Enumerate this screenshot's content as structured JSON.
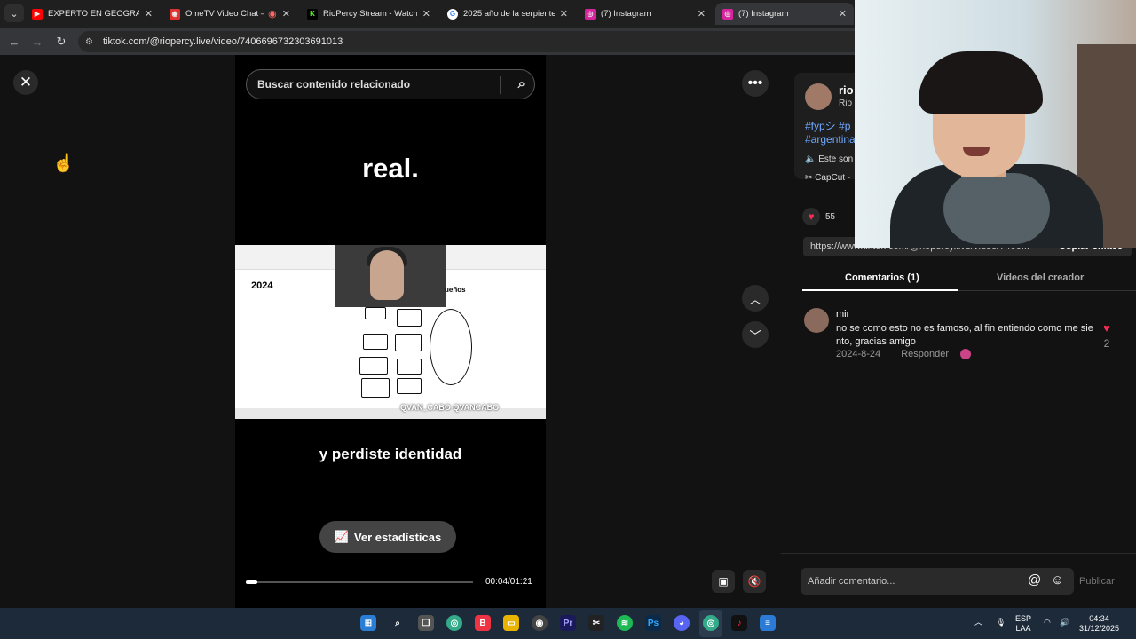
{
  "browser": {
    "tabs": [
      {
        "label": "EXPERTO EN GEOGRAFÍA",
        "icon": "youtube-icon",
        "color": "#ff0000"
      },
      {
        "label": "OmeTV Video Chat –",
        "icon": "ometv-icon",
        "color": "#e0312f"
      },
      {
        "label": "RioPercy Stream - Watch L",
        "icon": "kick-icon",
        "color": "#53fc18"
      },
      {
        "label": "2025 año de la serpiente",
        "icon": "google-icon",
        "color": "#4285f4"
      },
      {
        "label": "(7) Instagram",
        "icon": "instagram-icon",
        "color": "#d6249f"
      },
      {
        "label": "(7) Instagram",
        "icon": "instagram-icon",
        "color": "#d6249f"
      }
    ],
    "url": "tiktok.com/@riopercy.live/video/7406696732303691013"
  },
  "player": {
    "search_placeholder": "Buscar contenido relacionado",
    "caption_top": "real.",
    "caption_bottom": "y perdiste identidad",
    "frame_year": "2024",
    "frame_word": "ueños",
    "watermark": "QVAN_CABO   QVANCABO",
    "stats_label": "Ver estadísticas",
    "time": "00:04/01:21",
    "progress": 0.05
  },
  "panel": {
    "username": "rio",
    "display_name": "Rio",
    "hashtags": "#fypシ #p #argentina",
    "sound": "Este son",
    "capcut": "CapCut -",
    "likes": "55",
    "link": "https://www.tiktok.com/@riopercy.live/video/7406...",
    "copy_link": "Copiar enlace",
    "tab_comments": "Comentarios (1)",
    "tab_creator": "Videos del creador",
    "comment": {
      "user": "mir",
      "text": "no se como esto no es famoso, al fin entiendo como me sie nto, gracias amigo",
      "date": "2024-8-24",
      "reply": "Responder",
      "likes": "2"
    },
    "input_placeholder": "Añadir comentario...",
    "publish": "Publicar"
  },
  "taskbar": {
    "lang_top": "ESP",
    "lang_bottom": "LAA",
    "time": "04:34",
    "date": "31/12/2025"
  },
  "colors": {
    "accent": "#fe2c55",
    "hashtag": "#6fa8ff",
    "taskbar": "#1c2a3a"
  }
}
